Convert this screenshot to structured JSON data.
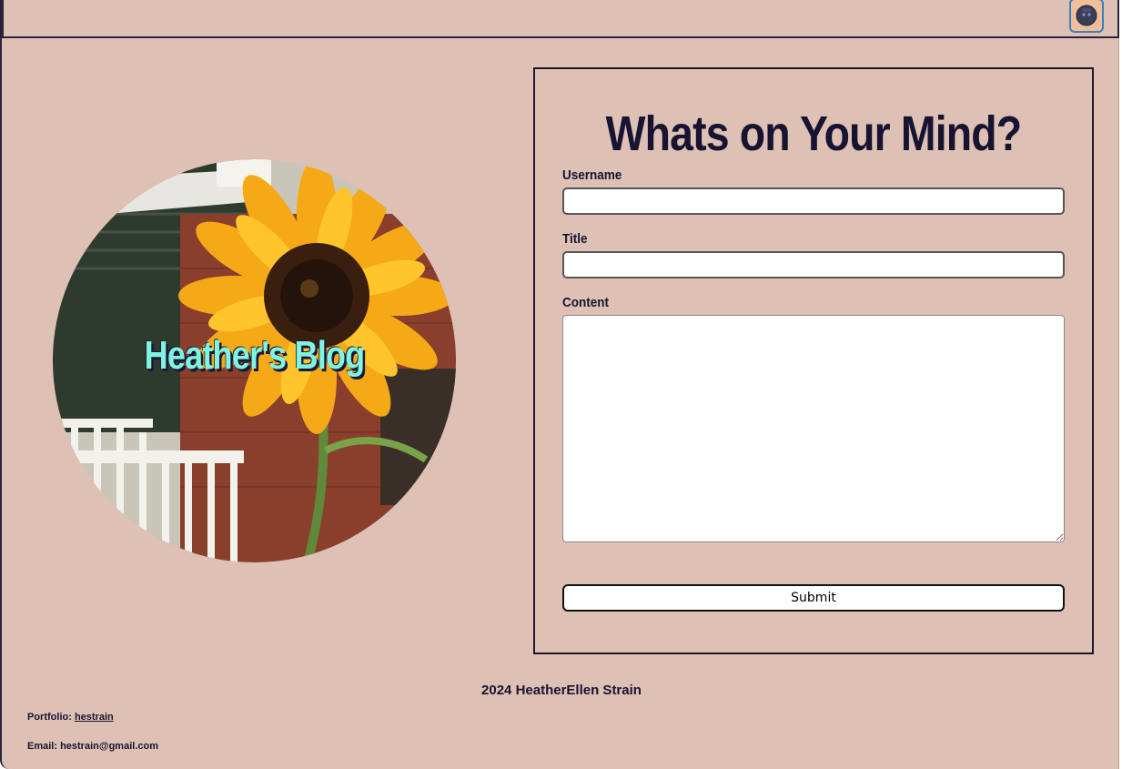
{
  "header": {
    "theme_toggle_icon": "moon-face-icon"
  },
  "hero": {
    "title": "Heather's Blog",
    "image": "sunflower-photo"
  },
  "form": {
    "heading": "Whats on Your Mind?",
    "username_label": "Username",
    "username_value": "",
    "title_label": "Title",
    "title_value": "",
    "content_label": "Content",
    "content_value": "",
    "submit_label": "Submit"
  },
  "footer": {
    "copyright": "2024 HeatherEllen Strain",
    "portfolio_prefix": "Portfolio: ",
    "portfolio_link": "hestrain",
    "email": "Email: hestrain@gmail.com"
  },
  "colors": {
    "background": "#dfc0b5",
    "text": "#161431",
    "hero_title": "#7ff5e0",
    "toggle_bg": "#f0bf9a"
  }
}
